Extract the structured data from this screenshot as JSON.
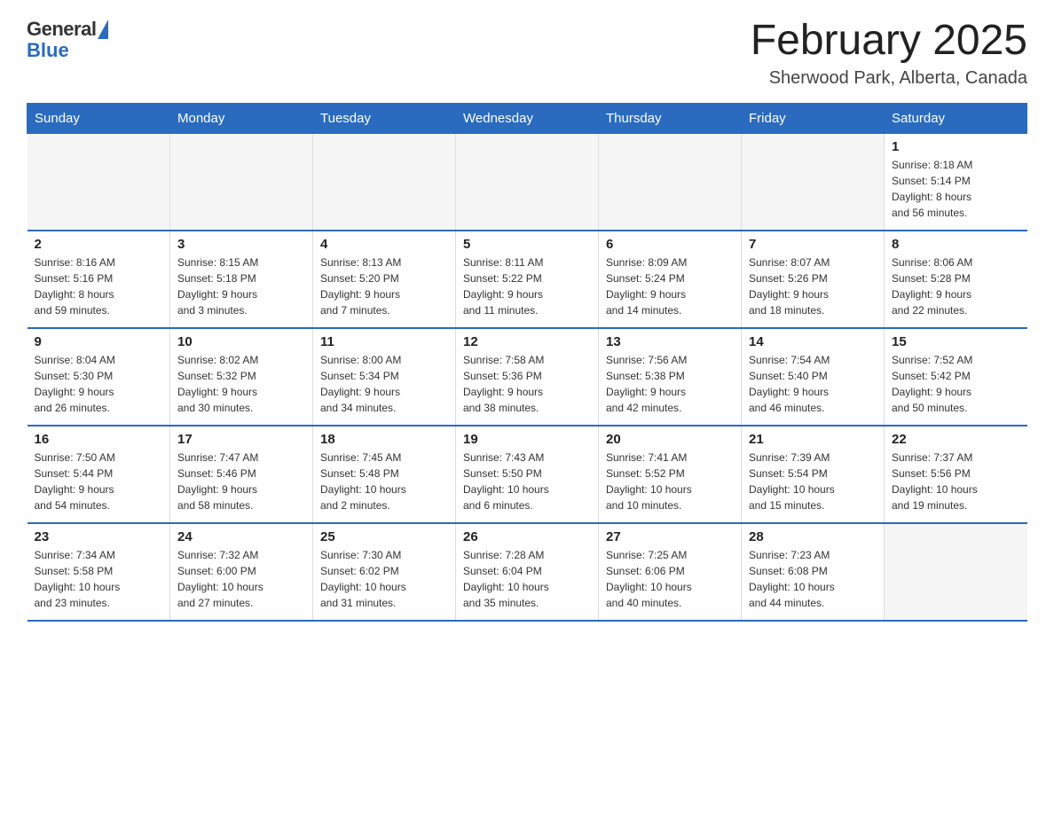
{
  "header": {
    "logo_general": "General",
    "logo_blue": "Blue",
    "month_title": "February 2025",
    "location": "Sherwood Park, Alberta, Canada"
  },
  "days_of_week": [
    "Sunday",
    "Monday",
    "Tuesday",
    "Wednesday",
    "Thursday",
    "Friday",
    "Saturday"
  ],
  "weeks": [
    [
      {
        "day": "",
        "info": ""
      },
      {
        "day": "",
        "info": ""
      },
      {
        "day": "",
        "info": ""
      },
      {
        "day": "",
        "info": ""
      },
      {
        "day": "",
        "info": ""
      },
      {
        "day": "",
        "info": ""
      },
      {
        "day": "1",
        "info": "Sunrise: 8:18 AM\nSunset: 5:14 PM\nDaylight: 8 hours\nand 56 minutes."
      }
    ],
    [
      {
        "day": "2",
        "info": "Sunrise: 8:16 AM\nSunset: 5:16 PM\nDaylight: 8 hours\nand 59 minutes."
      },
      {
        "day": "3",
        "info": "Sunrise: 8:15 AM\nSunset: 5:18 PM\nDaylight: 9 hours\nand 3 minutes."
      },
      {
        "day": "4",
        "info": "Sunrise: 8:13 AM\nSunset: 5:20 PM\nDaylight: 9 hours\nand 7 minutes."
      },
      {
        "day": "5",
        "info": "Sunrise: 8:11 AM\nSunset: 5:22 PM\nDaylight: 9 hours\nand 11 minutes."
      },
      {
        "day": "6",
        "info": "Sunrise: 8:09 AM\nSunset: 5:24 PM\nDaylight: 9 hours\nand 14 minutes."
      },
      {
        "day": "7",
        "info": "Sunrise: 8:07 AM\nSunset: 5:26 PM\nDaylight: 9 hours\nand 18 minutes."
      },
      {
        "day": "8",
        "info": "Sunrise: 8:06 AM\nSunset: 5:28 PM\nDaylight: 9 hours\nand 22 minutes."
      }
    ],
    [
      {
        "day": "9",
        "info": "Sunrise: 8:04 AM\nSunset: 5:30 PM\nDaylight: 9 hours\nand 26 minutes."
      },
      {
        "day": "10",
        "info": "Sunrise: 8:02 AM\nSunset: 5:32 PM\nDaylight: 9 hours\nand 30 minutes."
      },
      {
        "day": "11",
        "info": "Sunrise: 8:00 AM\nSunset: 5:34 PM\nDaylight: 9 hours\nand 34 minutes."
      },
      {
        "day": "12",
        "info": "Sunrise: 7:58 AM\nSunset: 5:36 PM\nDaylight: 9 hours\nand 38 minutes."
      },
      {
        "day": "13",
        "info": "Sunrise: 7:56 AM\nSunset: 5:38 PM\nDaylight: 9 hours\nand 42 minutes."
      },
      {
        "day": "14",
        "info": "Sunrise: 7:54 AM\nSunset: 5:40 PM\nDaylight: 9 hours\nand 46 minutes."
      },
      {
        "day": "15",
        "info": "Sunrise: 7:52 AM\nSunset: 5:42 PM\nDaylight: 9 hours\nand 50 minutes."
      }
    ],
    [
      {
        "day": "16",
        "info": "Sunrise: 7:50 AM\nSunset: 5:44 PM\nDaylight: 9 hours\nand 54 minutes."
      },
      {
        "day": "17",
        "info": "Sunrise: 7:47 AM\nSunset: 5:46 PM\nDaylight: 9 hours\nand 58 minutes."
      },
      {
        "day": "18",
        "info": "Sunrise: 7:45 AM\nSunset: 5:48 PM\nDaylight: 10 hours\nand 2 minutes."
      },
      {
        "day": "19",
        "info": "Sunrise: 7:43 AM\nSunset: 5:50 PM\nDaylight: 10 hours\nand 6 minutes."
      },
      {
        "day": "20",
        "info": "Sunrise: 7:41 AM\nSunset: 5:52 PM\nDaylight: 10 hours\nand 10 minutes."
      },
      {
        "day": "21",
        "info": "Sunrise: 7:39 AM\nSunset: 5:54 PM\nDaylight: 10 hours\nand 15 minutes."
      },
      {
        "day": "22",
        "info": "Sunrise: 7:37 AM\nSunset: 5:56 PM\nDaylight: 10 hours\nand 19 minutes."
      }
    ],
    [
      {
        "day": "23",
        "info": "Sunrise: 7:34 AM\nSunset: 5:58 PM\nDaylight: 10 hours\nand 23 minutes."
      },
      {
        "day": "24",
        "info": "Sunrise: 7:32 AM\nSunset: 6:00 PM\nDaylight: 10 hours\nand 27 minutes."
      },
      {
        "day": "25",
        "info": "Sunrise: 7:30 AM\nSunset: 6:02 PM\nDaylight: 10 hours\nand 31 minutes."
      },
      {
        "day": "26",
        "info": "Sunrise: 7:28 AM\nSunset: 6:04 PM\nDaylight: 10 hours\nand 35 minutes."
      },
      {
        "day": "27",
        "info": "Sunrise: 7:25 AM\nSunset: 6:06 PM\nDaylight: 10 hours\nand 40 minutes."
      },
      {
        "day": "28",
        "info": "Sunrise: 7:23 AM\nSunset: 6:08 PM\nDaylight: 10 hours\nand 44 minutes."
      },
      {
        "day": "",
        "info": ""
      }
    ]
  ]
}
